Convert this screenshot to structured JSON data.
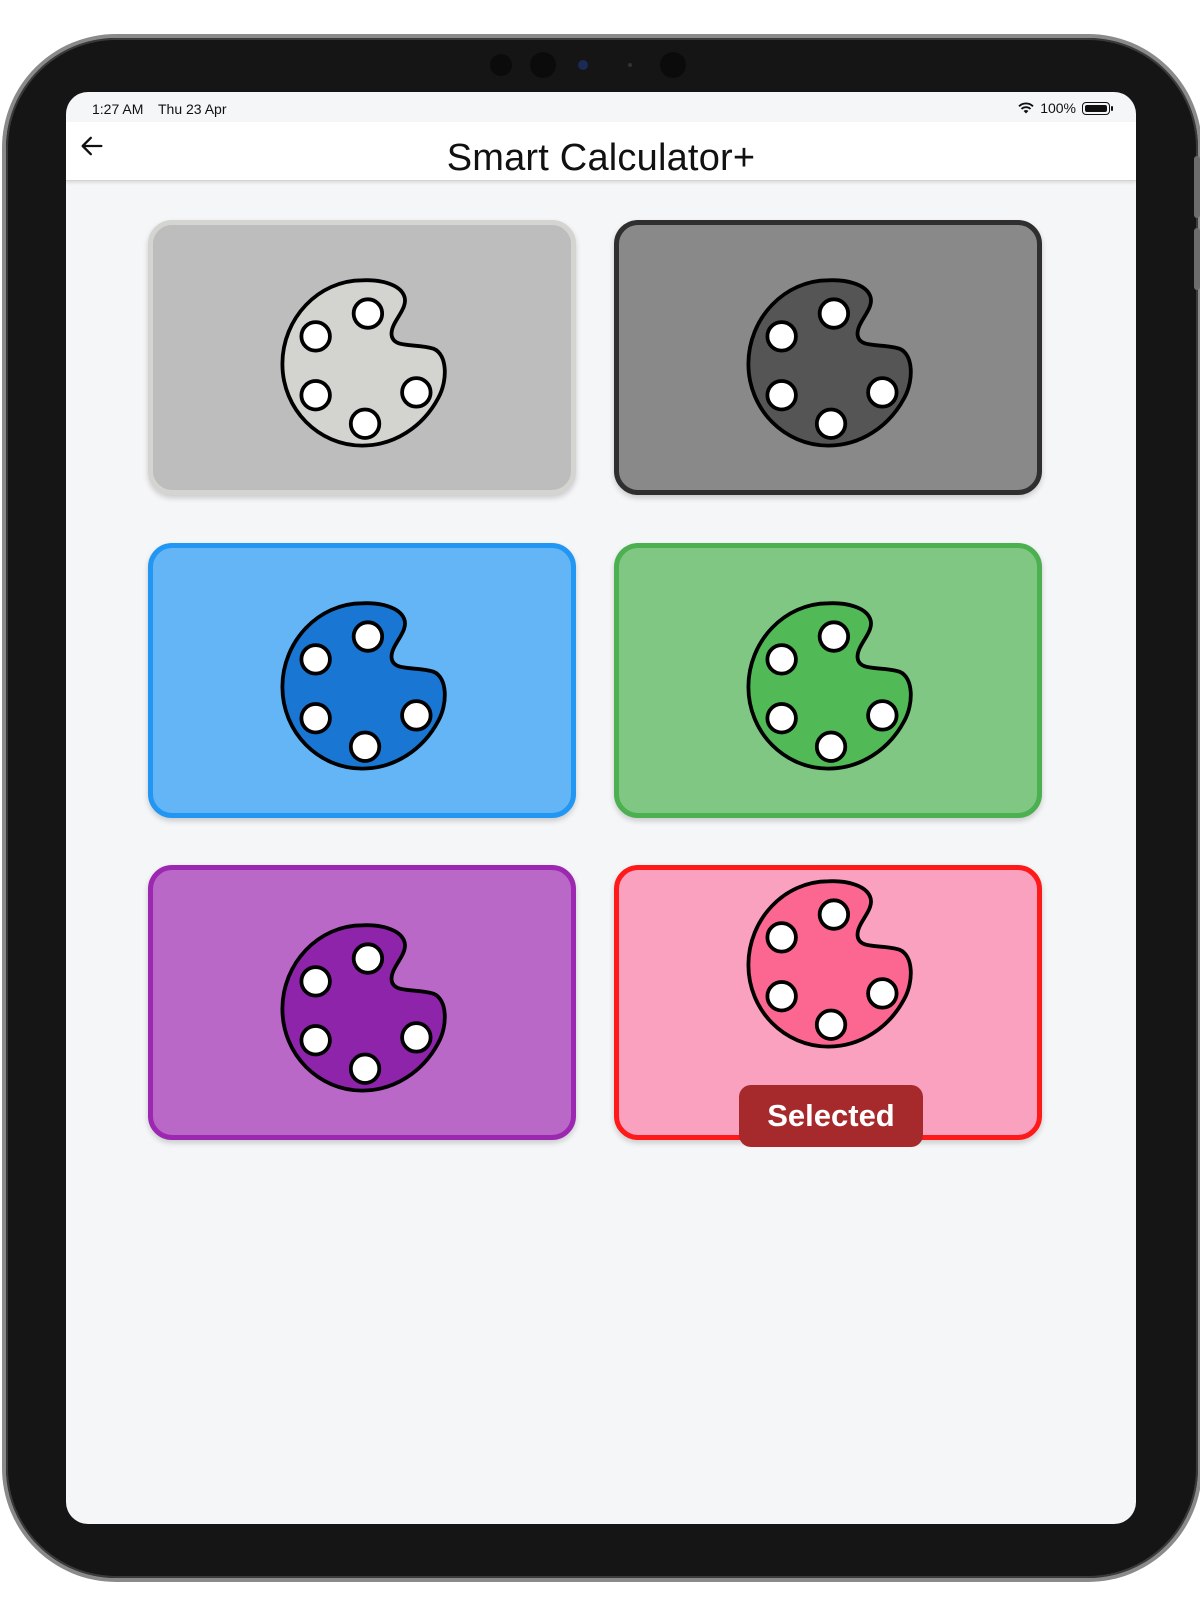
{
  "status_bar": {
    "time": "1:27 AM",
    "date": "Thu 23 Apr",
    "battery": "100%"
  },
  "app_bar": {
    "title": "Smart Calculator+",
    "back_icon": "arrow-left-icon"
  },
  "themes": [
    {
      "id": "light-gray",
      "icon": "palette-icon",
      "card_bg": "#bdbdbd",
      "border": "#d4d4d0",
      "palette_fill": "#d3d3cf",
      "selected": false
    },
    {
      "id": "dark-gray",
      "icon": "palette-icon",
      "card_bg": "#898989",
      "border": "#2f2f2f",
      "palette_fill": "#555555",
      "selected": false
    },
    {
      "id": "blue",
      "icon": "palette-icon",
      "card_bg": "#64b5f6",
      "border": "#2196f3",
      "palette_fill": "#1976d2",
      "selected": false
    },
    {
      "id": "green",
      "icon": "palette-icon",
      "card_bg": "#81c784",
      "border": "#4caf50",
      "palette_fill": "#52b957",
      "selected": false
    },
    {
      "id": "purple",
      "icon": "palette-icon",
      "card_bg": "#ba68c8",
      "border": "#9c27b0",
      "palette_fill": "#8e24aa",
      "selected": false
    },
    {
      "id": "pink",
      "icon": "palette-icon",
      "card_bg": "#f9a1be",
      "border": "#ff1a1a",
      "palette_fill": "#fc6792",
      "selected": true,
      "badge": "Selected",
      "badge_color": "#a62a2c"
    }
  ]
}
